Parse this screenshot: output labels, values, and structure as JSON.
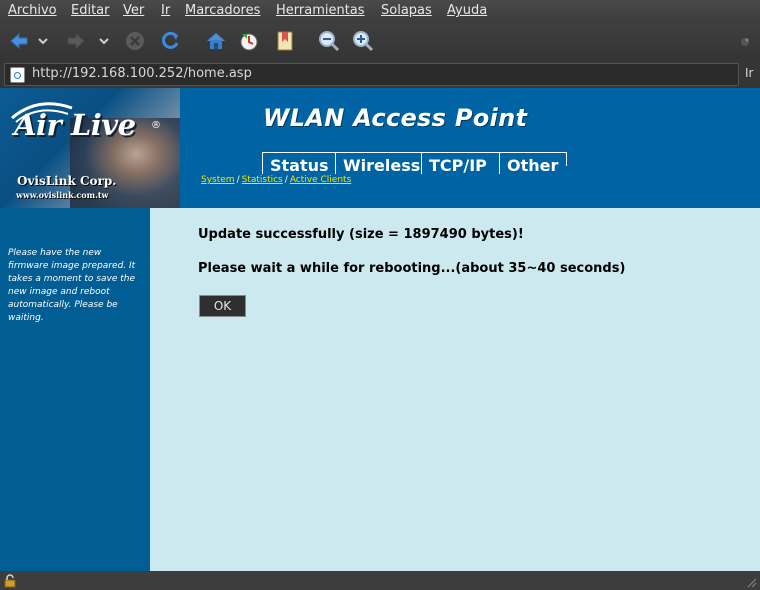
{
  "browser": {
    "menu": [
      "Archivo",
      "Editar",
      "Ver",
      "Ir",
      "Marcadores",
      "Herramientas",
      "Solapas",
      "Ayuda"
    ],
    "url": "http://192.168.100.252/home.asp",
    "go_label": "Ir",
    "toolbar_icons": [
      "back-icon",
      "back-history-icon",
      "forward-icon",
      "forward-history-icon",
      "stop-icon",
      "reload-icon",
      "home-icon",
      "history-icon",
      "bookmark-icon",
      "zoom-out-icon",
      "zoom-in-icon",
      "throbber-icon"
    ]
  },
  "header": {
    "logo_text": "Air Live",
    "logo_reg": "®",
    "logo_corp": "OvisLink Corp.",
    "logo_web": "www.ovislink.com.tw",
    "title": "WLAN Access Point",
    "tabs": [
      "Status",
      "Wireless",
      "TCP/IP",
      "Other"
    ],
    "subnav": [
      "System",
      "Statistics",
      "Active Clients"
    ],
    "subnav_sep": "/"
  },
  "sidebar": {
    "text": "Please have the new firmware image prepared. It takes a moment to save the new image and reboot automatically. Please be waiting."
  },
  "content": {
    "message1": "Update successfully (size = 1897490 bytes)!",
    "message2": "Please wait a while for rebooting...(about 35~40 seconds)",
    "ok_label": "OK"
  },
  "colors": {
    "header_blue": "#0064a4",
    "sidebar_blue": "#015e94",
    "content_bg": "#cde9f0",
    "subnav_yellow": "#ffe000"
  }
}
